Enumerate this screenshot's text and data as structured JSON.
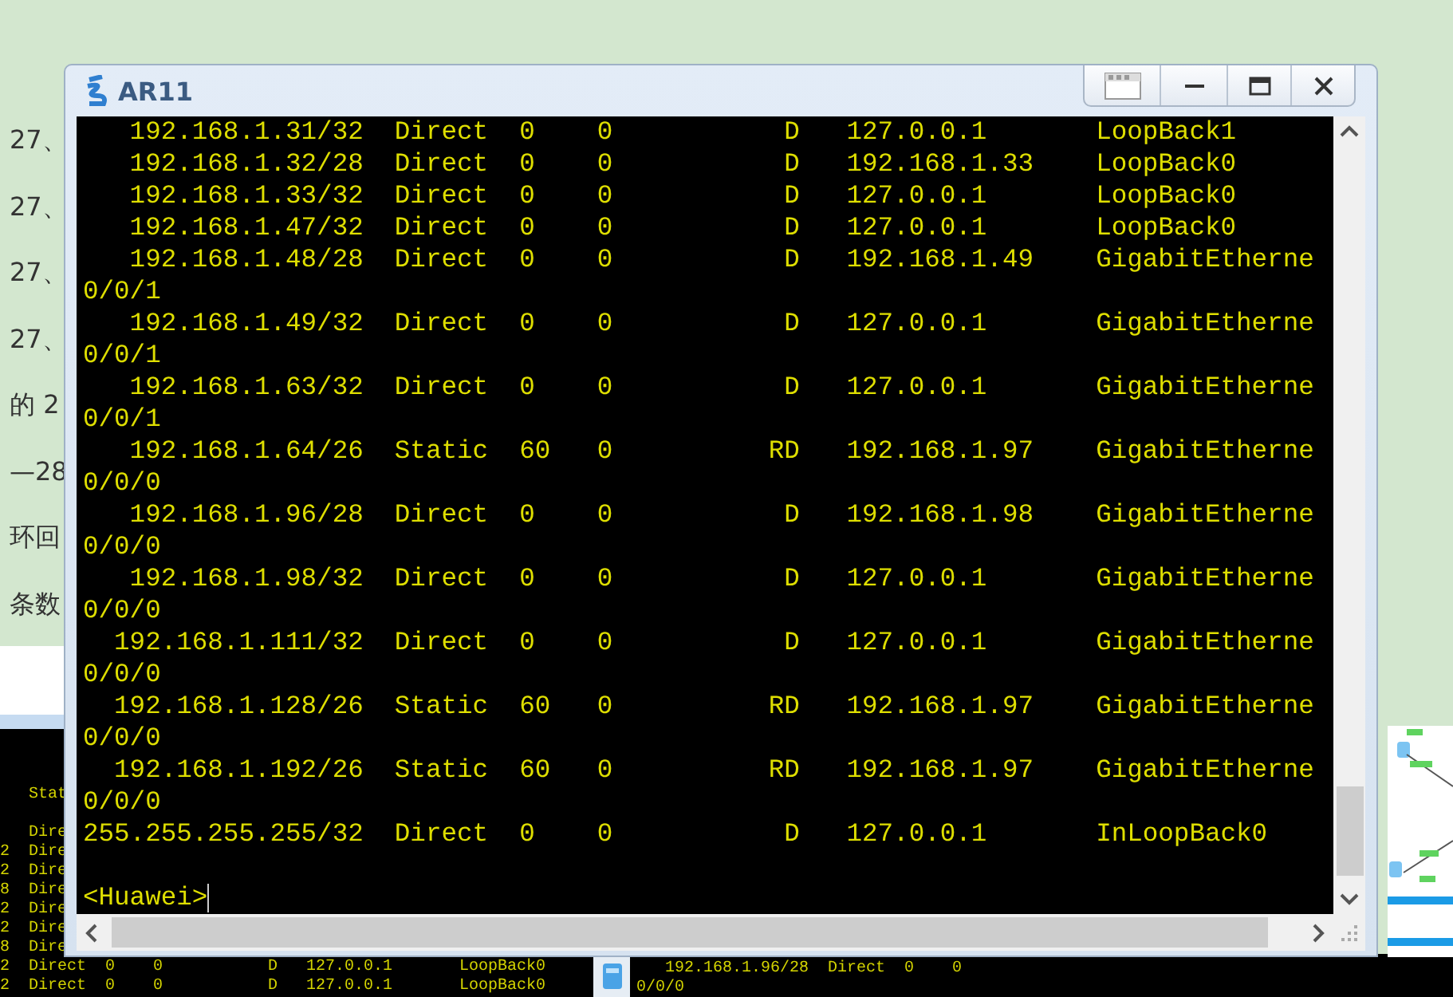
{
  "page_text": [
    "27、",
    "27、",
    "27、",
    "27、",
    "的 2",
    "—28",
    "环回",
    "条数"
  ],
  "window": {
    "title": "AR11",
    "terminal": {
      "lines": [
        "   192.168.1.31/32  Direct  0    0           D   127.0.0.1       LoopBack1",
        "   192.168.1.32/28  Direct  0    0           D   192.168.1.33    LoopBack0",
        "   192.168.1.33/32  Direct  0    0           D   127.0.0.1       LoopBack0",
        "   192.168.1.47/32  Direct  0    0           D   127.0.0.1       LoopBack0",
        "   192.168.1.48/28  Direct  0    0           D   192.168.1.49    GigabitEtherne",
        "0/0/1",
        "   192.168.1.49/32  Direct  0    0           D   127.0.0.1       GigabitEtherne",
        "0/0/1",
        "   192.168.1.63/32  Direct  0    0           D   127.0.0.1       GigabitEtherne",
        "0/0/1",
        "   192.168.1.64/26  Static  60   0          RD   192.168.1.97    GigabitEtherne",
        "0/0/0",
        "   192.168.1.96/28  Direct  0    0           D   192.168.1.98    GigabitEtherne",
        "0/0/0",
        "   192.168.1.98/32  Direct  0    0           D   127.0.0.1       GigabitEtherne",
        "0/0/0",
        "  192.168.1.111/32  Direct  0    0           D   127.0.0.1       GigabitEtherne",
        "0/0/0",
        "  192.168.1.128/26  Static  60   0          RD   192.168.1.97    GigabitEtherne",
        "0/0/0",
        "  192.168.1.192/26  Static  60   0          RD   192.168.1.97    GigabitEtherne",
        "0/0/0",
        "255.255.255.255/32  Direct  0    0           D   127.0.0.1       InLoopBack0"
      ],
      "prompt": "<Huawei>"
    }
  },
  "background_terminal_left": {
    "header": "   Stat",
    "lines": [
      "   Dire",
      "2  Dire",
      "2  Dire",
      "8  Dire",
      "2  Dire",
      "2  Dire",
      "8  Dire",
      "2  Direct  0    0           D   127.0.0.1       LoopBack0",
      "2  Direct  0    0           D   127.0.0.1       LoopBack0"
    ]
  },
  "background_terminal_bottom": {
    "lines": [
      "   192.168.1.96/28  Direct  0    0",
      "0/0/0"
    ]
  }
}
